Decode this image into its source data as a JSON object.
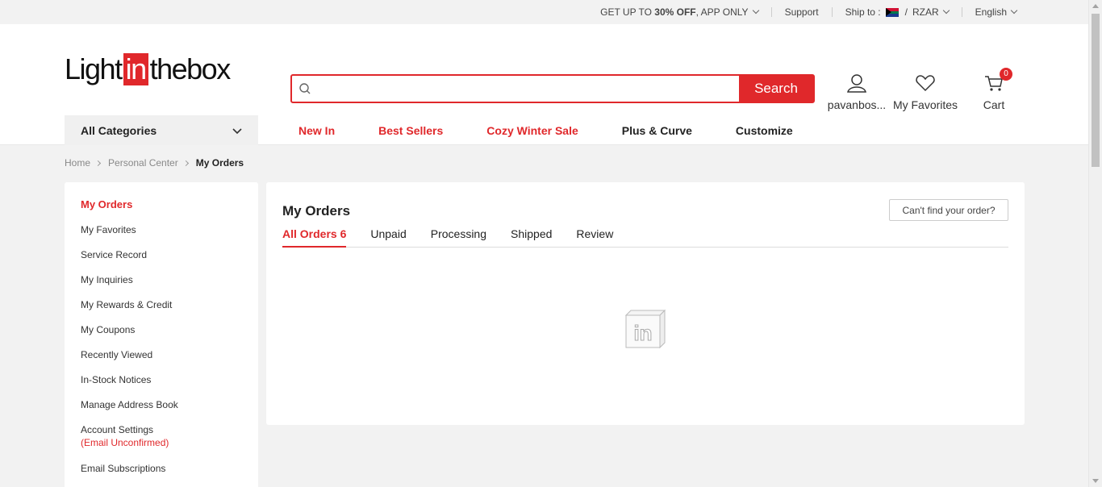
{
  "topbar": {
    "promo_prefix": "GET UP TO ",
    "promo_bold": "30% OFF",
    "promo_suffix": ", APP ONLY",
    "support": "Support",
    "ship_to": "Ship to :",
    "currency_sep": "/",
    "currency": "RZAR",
    "language": "English"
  },
  "header": {
    "logo_light": "Light",
    "logo_in": "in",
    "logo_thebox": "thebox",
    "search_placeholder": "",
    "search_button": "Search",
    "account_label": "pavanbos...",
    "favorites_label": "My Favorites",
    "cart_label": "Cart",
    "cart_count": "0"
  },
  "nav": {
    "all_categories": "All Categories",
    "links": [
      {
        "label": "New In",
        "color": "#e0282b"
      },
      {
        "label": "Best Sellers",
        "color": "#e0282b"
      },
      {
        "label": "Cozy Winter Sale",
        "color": "#e0282b"
      },
      {
        "label": "Plus & Curve",
        "color": "#222222"
      },
      {
        "label": "Customize",
        "color": "#222222"
      }
    ]
  },
  "breadcrumb": {
    "home": "Home",
    "personal_center": "Personal Center",
    "current": "My Orders"
  },
  "sidebar": {
    "items": [
      {
        "label": "My Orders",
        "active": true
      },
      {
        "label": "My Favorites"
      },
      {
        "label": "Service Record"
      },
      {
        "label": "My Inquiries"
      },
      {
        "label": "My Rewards & Credit"
      },
      {
        "label": "My Coupons"
      },
      {
        "label": "Recently Viewed"
      },
      {
        "label": "In-Stock Notices"
      },
      {
        "label": "Manage Address Book"
      },
      {
        "label": "Account Settings",
        "sub": "(Email Unconfirmed)"
      },
      {
        "label": "Email Subscriptions"
      }
    ]
  },
  "main": {
    "title": "My Orders",
    "find_button": "Can't find your order?",
    "tabs": [
      {
        "label": "All Orders 6",
        "active": true
      },
      {
        "label": "Unpaid"
      },
      {
        "label": "Processing"
      },
      {
        "label": "Shipped"
      },
      {
        "label": "Review"
      }
    ],
    "empty_icon": "in-box-icon",
    "empty_icon_text": "in"
  },
  "colors": {
    "accent": "#e0282b"
  }
}
